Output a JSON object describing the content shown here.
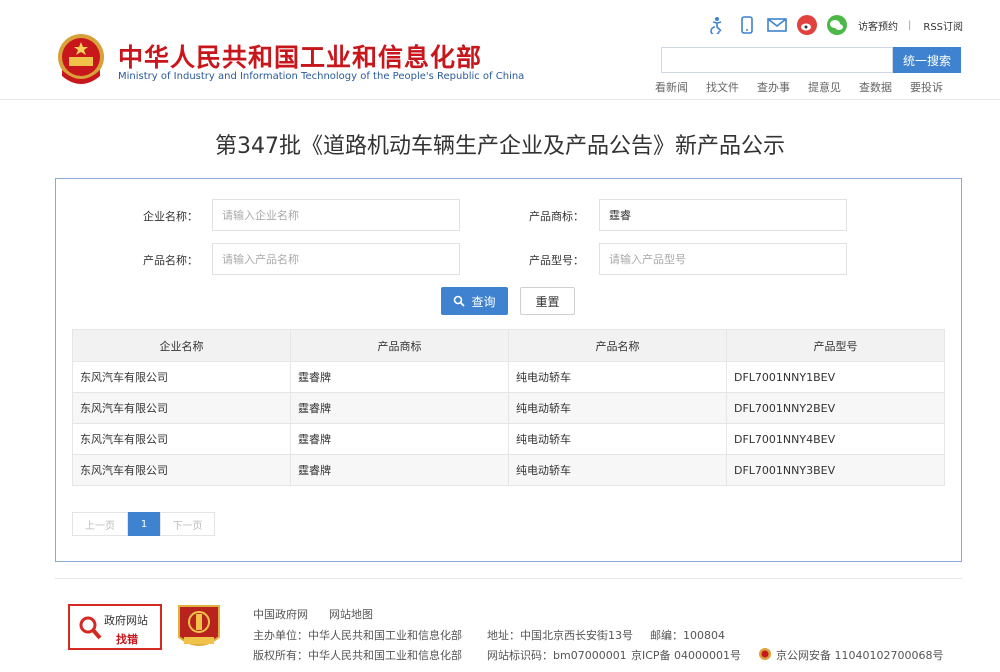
{
  "header": {
    "title": "中华人民共和国工业和信息化部",
    "subtitle": "Ministry of Industry and Information Technology of the People's Republic of China",
    "links": {
      "visitor": "访客预约",
      "separator": "|",
      "rss": "RSS订阅"
    },
    "search_button": "统一搜索",
    "search_placeholder": "",
    "nav": [
      "看新闻",
      "找文件",
      "查办事",
      "提意见",
      "查数据",
      "要投诉"
    ]
  },
  "page_title": "第347批《道路机动车辆生产企业及产品公告》新产品公示",
  "form": {
    "company_label": "企业名称：",
    "company_placeholder": "请输入企业名称",
    "brand_label": "产品商标：",
    "brand_value": "霆睿",
    "product_label": "产品名称：",
    "product_placeholder": "请输入产品名称",
    "model_label": "产品型号：",
    "model_placeholder": "请输入产品型号",
    "query_button": "查询",
    "reset_button": "重置"
  },
  "table": {
    "columns": [
      "企业名称",
      "产品商标",
      "产品名称",
      "产品型号"
    ],
    "rows": [
      [
        "东风汽车有限公司",
        "霆睿牌",
        "纯电动轿车",
        "DFL7001NNY1BEV"
      ],
      [
        "东风汽车有限公司",
        "霆睿牌",
        "纯电动轿车",
        "DFL7001NNY2BEV"
      ],
      [
        "东风汽车有限公司",
        "霆睿牌",
        "纯电动轿车",
        "DFL7001NNY4BEV"
      ],
      [
        "东风汽车有限公司",
        "霆睿牌",
        "纯电动轿车",
        "DFL7001NNY3BEV"
      ]
    ]
  },
  "pagination": {
    "prev": "上一页",
    "current": "1",
    "next": "下一页"
  },
  "footer": {
    "gov_badge_line1": "政府网站",
    "gov_badge_line2": "找错",
    "links": [
      "中国政府网",
      "网站地图"
    ],
    "sponsor": "主办单位：中华人民共和国工业和信息化部",
    "address": "地址：中国北京西长安街13号",
    "postcode": "邮编：100804",
    "copyright": "版权所有：中华人民共和国工业和信息化部",
    "site_code": "网站标识码：bm07000001",
    "icp": "京ICP备 04000001号",
    "police": "京公网安备 11040102700068号"
  },
  "colors": {
    "accent": "#3f82cf",
    "brand_red": "#c8161d",
    "panel_border": "#86a9d7"
  }
}
